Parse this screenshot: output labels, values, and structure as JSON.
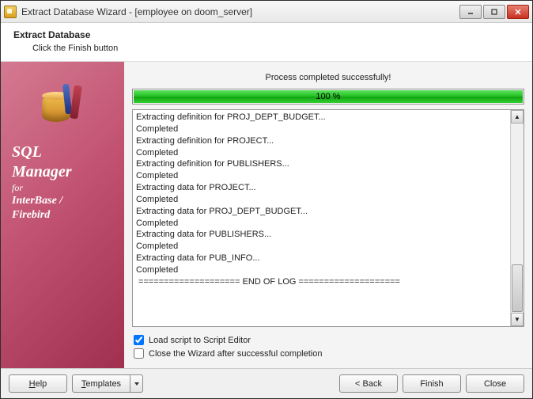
{
  "window": {
    "title": "Extract Database Wizard - [employee on doom_server]"
  },
  "header": {
    "title": "Extract Database",
    "subtitle": "Click the Finish button"
  },
  "sidebar": {
    "line1": "SQL",
    "line2": "Manager",
    "line3": "for",
    "line4": "InterBase /",
    "line5": "Firebird"
  },
  "main": {
    "status": "Process completed successfully!",
    "progress_text": "100 %",
    "log": "Extracting definition for PROJ_DEPT_BUDGET...\nCompleted\nExtracting definition for PROJECT...\nCompleted\nExtracting definition for PUBLISHERS...\nCompleted\nExtracting data for PROJECT...\nCompleted\nExtracting data for PROJ_DEPT_BUDGET...\nCompleted\nExtracting data for PUBLISHERS...\nCompleted\nExtracting data for PUB_INFO...\nCompleted\n ==================== END OF LOG ===================="
  },
  "checks": {
    "load_script": "Load script to Script Editor",
    "close_after": "Close the Wizard after successful completion"
  },
  "footer": {
    "help": "Help",
    "templates": "Templates",
    "back": "< Back",
    "finish": "Finish",
    "close": "Close"
  }
}
